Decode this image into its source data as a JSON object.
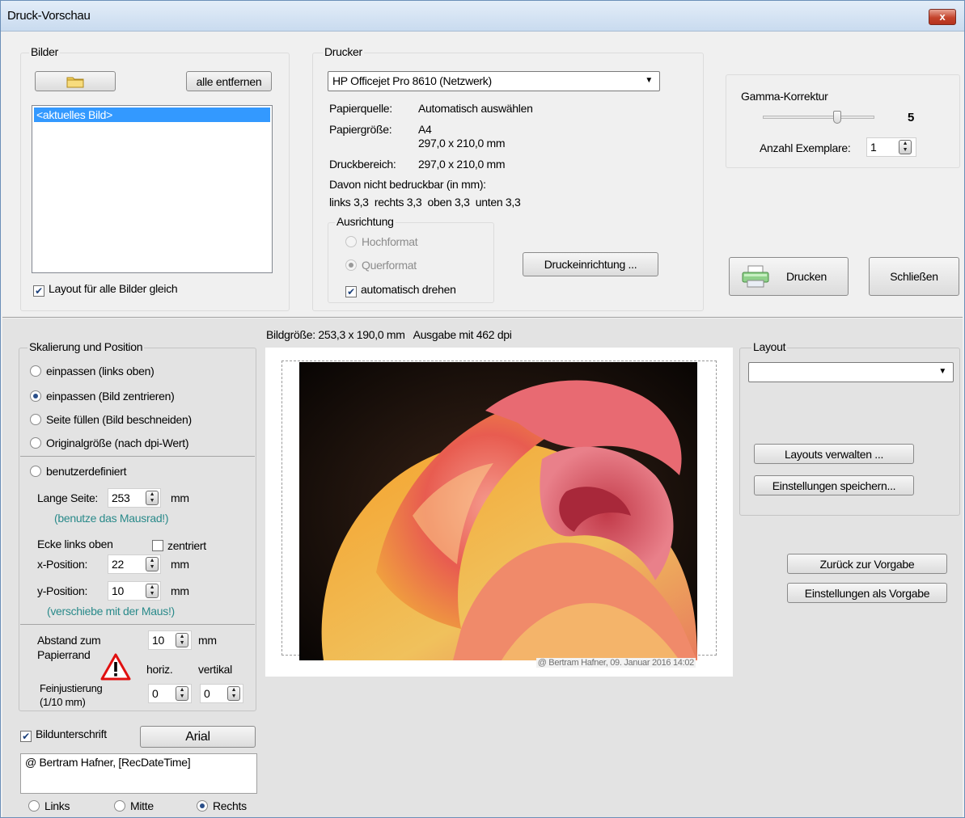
{
  "window": {
    "title": "Druck-Vorschau",
    "close_label": "x"
  },
  "bilder": {
    "group_label": "Bilder",
    "remove_all_label": "alle entfernen",
    "list_items": [
      "<aktuelles Bild>"
    ],
    "layout_same_label": "Layout für alle Bilder gleich",
    "layout_same_checked": true
  },
  "drucker": {
    "group_label": "Drucker",
    "printer_selected": "HP Officejet Pro 8610 (Netzwerk)",
    "papierquelle_label": "Papierquelle:",
    "papierquelle_value": "Automatisch auswählen",
    "papiergroesse_label": "Papiergröße:",
    "papiergroesse_value": "A4",
    "papiergroesse_dim": "297,0 x 210,0 mm",
    "druckbereich_label": "Druckbereich:",
    "druckbereich_value": "297,0 x 210,0 mm",
    "unprintable_label": "Davon nicht bedruckbar (in mm):",
    "margins_text": "links 3,3  rechts 3,3  oben 3,3  unten 3,3",
    "ausrichtung_label": "Ausrichtung",
    "hochformat_label": "Hochformat",
    "querformat_label": "Querformat",
    "auto_rotate_label": "automatisch drehen",
    "auto_rotate_checked": true,
    "setup_button": "Druckeinrichtung ..."
  },
  "gamma": {
    "label": "Gamma-Korrektur",
    "value": "5",
    "exemplare_label": "Anzahl Exemplare:",
    "exemplare_value": "1"
  },
  "actions": {
    "print_label": "Drucken",
    "close_label": "Schließen"
  },
  "preview": {
    "info_text": "Bildgröße: 253,3 x 190,0 mm   Ausgabe mit 462 dpi",
    "caption": "@ Bertram Hafner, 09. Januar 2016  14:02"
  },
  "skalierung": {
    "group_label": "Skalierung und Position",
    "options": [
      "einpassen (links oben)",
      "einpassen (Bild zentrieren)",
      "Seite füllen (Bild beschneiden)",
      "Originalgröße (nach dpi-Wert)"
    ],
    "selected_index": 1,
    "custom_label": "benutzerdefiniert",
    "lange_seite_label": "Lange Seite:",
    "lange_seite_value": "253",
    "unit_mm": "mm",
    "mausrad_hint": "(benutze das Mausrad!)",
    "ecke_label": "Ecke links oben",
    "zentriert_label": "zentriert",
    "x_label": "x-Position:",
    "x_value": "22",
    "y_label": "y-Position:",
    "y_value": "10",
    "maus_hint": "(verschiebe mit der Maus!)",
    "abstand_label_1": "Abstand  zum",
    "abstand_label_2": "Papierrand",
    "abstand_value": "10",
    "horiz_label": "horiz.",
    "vertikal_label": "vertikal",
    "fein_label_1": "Feinjustierung",
    "fein_label_2": "(1/10 mm)",
    "fein_h_value": "0",
    "fein_v_value": "0"
  },
  "bildunterschrift": {
    "label": "Bildunterschrift",
    "checked": true,
    "font_button": "Arial",
    "text": "@ Bertram Hafner, [RecDateTime]",
    "align_options": [
      "Links",
      "Mitte",
      "Rechts"
    ],
    "align_selected": 2
  },
  "layout": {
    "group_label": "Layout",
    "selected": "",
    "manage_button": "Layouts verwalten ...",
    "save_button": "Einstellungen speichern...",
    "reset_button": "Zurück zur Vorgabe",
    "as_default_button": "Einstellungen als Vorgabe"
  }
}
